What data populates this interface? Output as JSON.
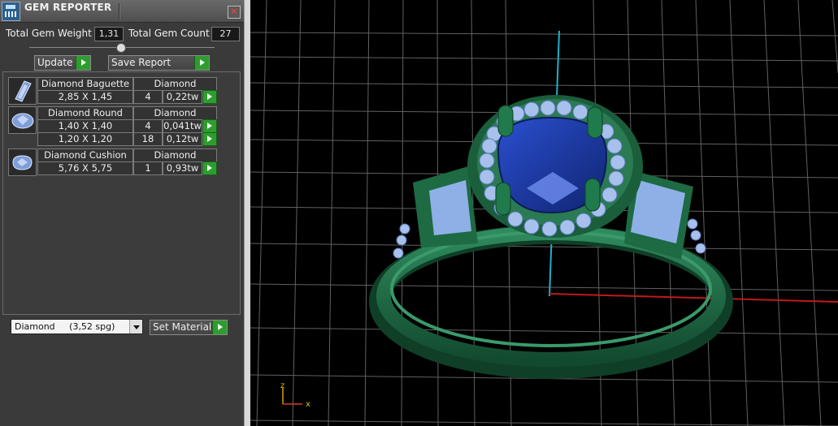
{
  "window": {
    "title": "GEM REPORTER",
    "close_glyph": "✕"
  },
  "summary": {
    "total_weight_label": "Total Gem Weight",
    "total_weight_value": "1,31",
    "total_count_label": "Total Gem Count",
    "total_count_value": "27"
  },
  "toolbar": {
    "update_label": "Update",
    "save_report_label": "Save Report"
  },
  "gems": [
    {
      "name": "Diamond Baguette",
      "material": "Diamond",
      "icon": "baguette-gem-icon",
      "rows": [
        {
          "size": "2,85 X 1,45",
          "qty": "4",
          "weight": "0,22tw"
        }
      ]
    },
    {
      "name": "Diamond Round",
      "material": "Diamond",
      "icon": "round-gem-icon",
      "rows": [
        {
          "size": "1,40 X 1,40",
          "qty": "4",
          "weight": "0,041tw"
        },
        {
          "size": "1,20 X 1,20",
          "qty": "18",
          "weight": "0,12tw"
        }
      ]
    },
    {
      "name": "Diamond Cushion",
      "material": "Diamond",
      "icon": "cushion-gem-icon",
      "rows": [
        {
          "size": "5,76 X 5,75",
          "qty": "1",
          "weight": "0,93tw"
        }
      ]
    }
  ],
  "material_select": {
    "value": "Diamond     (3,52 spg)"
  },
  "set_material_label": "Set Material",
  "viewport": {
    "axis_x_label": "x",
    "axis_z_label": "z",
    "colors": {
      "metal": "#1f6b45",
      "center_stone": "#1f3fb0",
      "side_stones": "#9fb8e6",
      "grid": "#8a8a8a",
      "x_axis": "#c0181b",
      "y_axis": "#1fb1c9"
    }
  }
}
